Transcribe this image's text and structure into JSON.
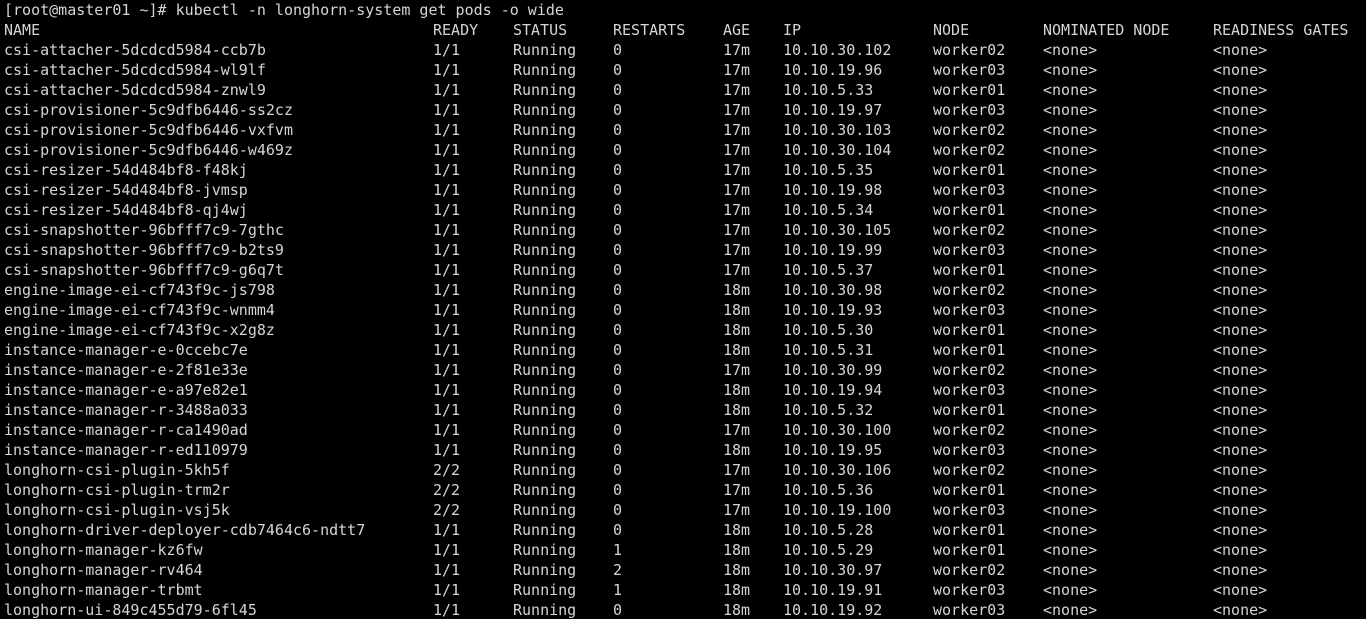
{
  "terminal": {
    "prompt": "[root@master01 ~]# kubectl -n longhorn-system get pods -o wide",
    "headers": [
      "NAME",
      "READY",
      "STATUS",
      "RESTARTS",
      "AGE",
      "IP",
      "NODE",
      "NOMINATED NODE",
      "READINESS GATES"
    ],
    "rows": [
      [
        "csi-attacher-5dcdcd5984-ccb7b",
        "1/1",
        "Running",
        "0",
        "17m",
        "10.10.30.102",
        "worker02",
        "<none>",
        "<none>"
      ],
      [
        "csi-attacher-5dcdcd5984-wl9lf",
        "1/1",
        "Running",
        "0",
        "17m",
        "10.10.19.96",
        "worker03",
        "<none>",
        "<none>"
      ],
      [
        "csi-attacher-5dcdcd5984-znwl9",
        "1/1",
        "Running",
        "0",
        "17m",
        "10.10.5.33",
        "worker01",
        "<none>",
        "<none>"
      ],
      [
        "csi-provisioner-5c9dfb6446-ss2cz",
        "1/1",
        "Running",
        "0",
        "17m",
        "10.10.19.97",
        "worker03",
        "<none>",
        "<none>"
      ],
      [
        "csi-provisioner-5c9dfb6446-vxfvm",
        "1/1",
        "Running",
        "0",
        "17m",
        "10.10.30.103",
        "worker02",
        "<none>",
        "<none>"
      ],
      [
        "csi-provisioner-5c9dfb6446-w469z",
        "1/1",
        "Running",
        "0",
        "17m",
        "10.10.30.104",
        "worker02",
        "<none>",
        "<none>"
      ],
      [
        "csi-resizer-54d484bf8-f48kj",
        "1/1",
        "Running",
        "0",
        "17m",
        "10.10.5.35",
        "worker01",
        "<none>",
        "<none>"
      ],
      [
        "csi-resizer-54d484bf8-jvmsp",
        "1/1",
        "Running",
        "0",
        "17m",
        "10.10.19.98",
        "worker03",
        "<none>",
        "<none>"
      ],
      [
        "csi-resizer-54d484bf8-qj4wj",
        "1/1",
        "Running",
        "0",
        "17m",
        "10.10.5.34",
        "worker01",
        "<none>",
        "<none>"
      ],
      [
        "csi-snapshotter-96bfff7c9-7gthc",
        "1/1",
        "Running",
        "0",
        "17m",
        "10.10.30.105",
        "worker02",
        "<none>",
        "<none>"
      ],
      [
        "csi-snapshotter-96bfff7c9-b2ts9",
        "1/1",
        "Running",
        "0",
        "17m",
        "10.10.19.99",
        "worker03",
        "<none>",
        "<none>"
      ],
      [
        "csi-snapshotter-96bfff7c9-g6q7t",
        "1/1",
        "Running",
        "0",
        "17m",
        "10.10.5.37",
        "worker01",
        "<none>",
        "<none>"
      ],
      [
        "engine-image-ei-cf743f9c-js798",
        "1/1",
        "Running",
        "0",
        "18m",
        "10.10.30.98",
        "worker02",
        "<none>",
        "<none>"
      ],
      [
        "engine-image-ei-cf743f9c-wnmm4",
        "1/1",
        "Running",
        "0",
        "18m",
        "10.10.19.93",
        "worker03",
        "<none>",
        "<none>"
      ],
      [
        "engine-image-ei-cf743f9c-x2g8z",
        "1/1",
        "Running",
        "0",
        "18m",
        "10.10.5.30",
        "worker01",
        "<none>",
        "<none>"
      ],
      [
        "instance-manager-e-0ccebc7e",
        "1/1",
        "Running",
        "0",
        "18m",
        "10.10.5.31",
        "worker01",
        "<none>",
        "<none>"
      ],
      [
        "instance-manager-e-2f81e33e",
        "1/1",
        "Running",
        "0",
        "17m",
        "10.10.30.99",
        "worker02",
        "<none>",
        "<none>"
      ],
      [
        "instance-manager-e-a97e82e1",
        "1/1",
        "Running",
        "0",
        "18m",
        "10.10.19.94",
        "worker03",
        "<none>",
        "<none>"
      ],
      [
        "instance-manager-r-3488a033",
        "1/1",
        "Running",
        "0",
        "18m",
        "10.10.5.32",
        "worker01",
        "<none>",
        "<none>"
      ],
      [
        "instance-manager-r-ca1490ad",
        "1/1",
        "Running",
        "0",
        "17m",
        "10.10.30.100",
        "worker02",
        "<none>",
        "<none>"
      ],
      [
        "instance-manager-r-ed110979",
        "1/1",
        "Running",
        "0",
        "18m",
        "10.10.19.95",
        "worker03",
        "<none>",
        "<none>"
      ],
      [
        "longhorn-csi-plugin-5kh5f",
        "2/2",
        "Running",
        "0",
        "17m",
        "10.10.30.106",
        "worker02",
        "<none>",
        "<none>"
      ],
      [
        "longhorn-csi-plugin-trm2r",
        "2/2",
        "Running",
        "0",
        "17m",
        "10.10.5.36",
        "worker01",
        "<none>",
        "<none>"
      ],
      [
        "longhorn-csi-plugin-vsj5k",
        "2/2",
        "Running",
        "0",
        "17m",
        "10.10.19.100",
        "worker03",
        "<none>",
        "<none>"
      ],
      [
        "longhorn-driver-deployer-cdb7464c6-ndtt7",
        "1/1",
        "Running",
        "0",
        "18m",
        "10.10.5.28",
        "worker01",
        "<none>",
        "<none>"
      ],
      [
        "longhorn-manager-kz6fw",
        "1/1",
        "Running",
        "1",
        "18m",
        "10.10.5.29",
        "worker01",
        "<none>",
        "<none>"
      ],
      [
        "longhorn-manager-rv464",
        "1/1",
        "Running",
        "2",
        "18m",
        "10.10.30.97",
        "worker02",
        "<none>",
        "<none>"
      ],
      [
        "longhorn-manager-trbmt",
        "1/1",
        "Running",
        "1",
        "18m",
        "10.10.19.91",
        "worker03",
        "<none>",
        "<none>"
      ],
      [
        "longhorn-ui-849c455d79-6fl45",
        "1/1",
        "Running",
        "0",
        "18m",
        "10.10.19.92",
        "worker03",
        "<none>",
        "<none>"
      ]
    ]
  },
  "colors": {
    "background": "#000000",
    "foreground": "#d3d7cf"
  }
}
